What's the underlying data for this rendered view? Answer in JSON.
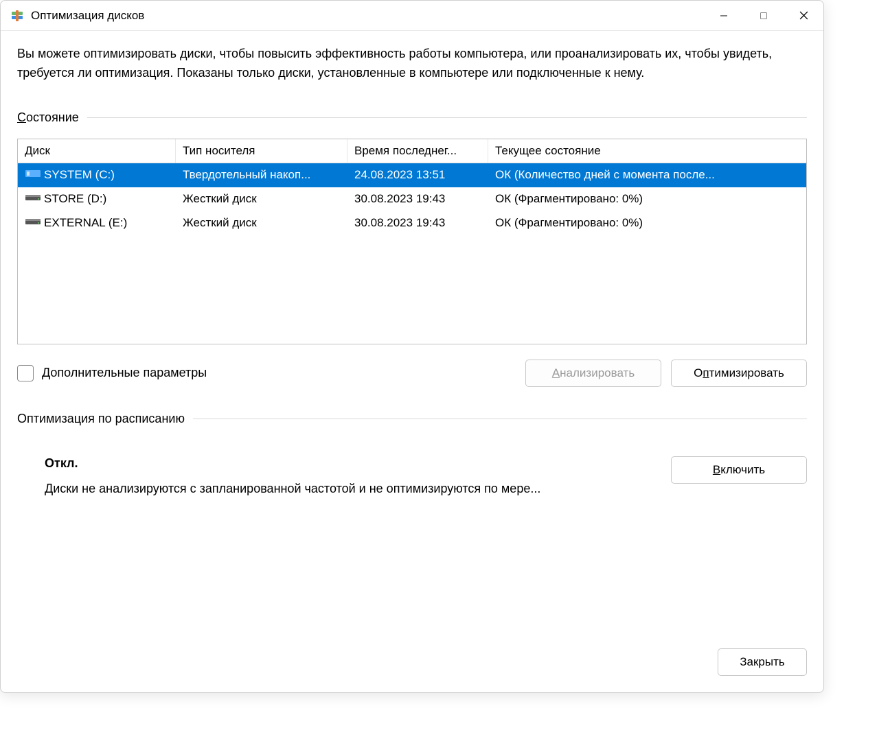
{
  "window": {
    "title": "Оптимизация дисков"
  },
  "description": "Вы можете оптимизировать диски, чтобы повысить эффективность работы  компьютера, или проанализировать их, чтобы увидеть, требуется ли оптимизация. Показаны только диски, установленные в компьютере или подключенные к нему.",
  "tableHeading": {
    "prefix": "С",
    "rest": "остояние"
  },
  "columns": {
    "disk": "Диск",
    "media": "Тип носителя",
    "time": "Время последнег...",
    "status": "Текущее состояние"
  },
  "rows": [
    {
      "name": "SYSTEM (C:)",
      "media": "Твердотельный накоп...",
      "time": "24.08.2023 13:51",
      "status": "ОК (Количество дней с момента после...",
      "selected": true,
      "ssd": true
    },
    {
      "name": "STORE (D:)",
      "media": "Жесткий диск",
      "time": "30.08.2023 19:43",
      "status": "ОК (Фрагментировано: 0%)",
      "selected": false,
      "ssd": false
    },
    {
      "name": "EXTERNAL (E:)",
      "media": "Жесткий диск",
      "time": "30.08.2023 19:43",
      "status": "ОК (Фрагментировано: 0%)",
      "selected": false,
      "ssd": false
    }
  ],
  "advancedCheckbox": "Дополнительные параметры",
  "buttons": {
    "analyze": {
      "prefix": "А",
      "rest": "нализировать"
    },
    "optimize": {
      "prefix": "О",
      "mid": "п",
      "rest": "тимизировать"
    },
    "enable": {
      "prefix": "В",
      "rest": "ключить"
    },
    "close": "Закрыть"
  },
  "scheduleHeading": "Оптимизация по расписанию",
  "schedule": {
    "status": "Откл.",
    "desc": "Диски не анализируются с запланированной частотой и не оптимизируются по мере..."
  }
}
